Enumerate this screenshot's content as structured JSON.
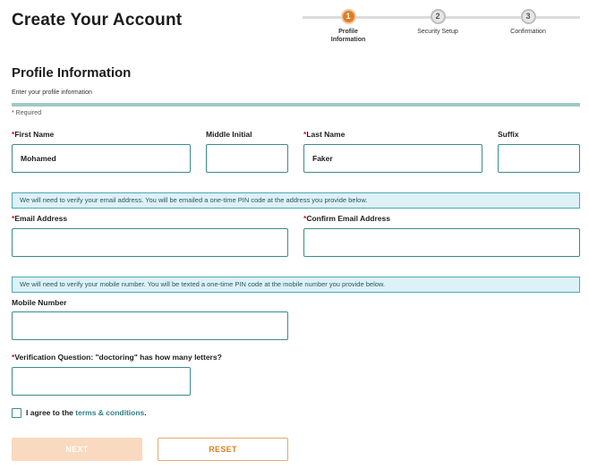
{
  "header": {
    "title": "Create Your Account"
  },
  "stepper": {
    "steps": [
      {
        "number": "1",
        "label_line1": "Profile",
        "label_line2": "Information",
        "active": true
      },
      {
        "number": "2",
        "label_line1": "Security Setup",
        "label_line2": "",
        "active": false
      },
      {
        "number": "3",
        "label_line1": "Confirmation",
        "label_line2": "",
        "active": false
      }
    ]
  },
  "section": {
    "title": "Profile Information",
    "subtitle": "Enter your profile information",
    "required_star": "*",
    "required_note": " Required"
  },
  "fields": {
    "first_name": {
      "star": "*",
      "label": "First Name",
      "value": "Mohamed"
    },
    "middle_initial": {
      "label": "Middle Initial",
      "value": ""
    },
    "last_name": {
      "star": "*",
      "label": "Last Name",
      "value": "Faker"
    },
    "suffix": {
      "label": "Suffix",
      "value": ""
    },
    "email": {
      "star": "*",
      "label": "Email Address",
      "value": ""
    },
    "confirm_email": {
      "star": "*",
      "label": "Confirm Email Address",
      "value": ""
    },
    "mobile": {
      "label": "Mobile Number",
      "value": ""
    },
    "verification": {
      "star": "*",
      "label": "Verification Question: \"doctoring\" has how many letters?",
      "value": ""
    }
  },
  "info": {
    "email_notice": "We will need to verify your email address. You will be emailed a one-time PIN code at the address you provide below.",
    "mobile_notice": "We will need to verify your mobile number. You will be texted a one-time PIN code at the mobile number you provide below."
  },
  "agree": {
    "text": "I agree to the ",
    "link": "terms & conditions",
    "suffix": ".",
    "checked": false
  },
  "buttons": {
    "next": "NEXT",
    "reset": "RESET"
  },
  "colors": {
    "accent": "#e07d22",
    "teal": "#3b8c88",
    "info_bg": "#ddf1f7",
    "required": "#d1111c"
  }
}
